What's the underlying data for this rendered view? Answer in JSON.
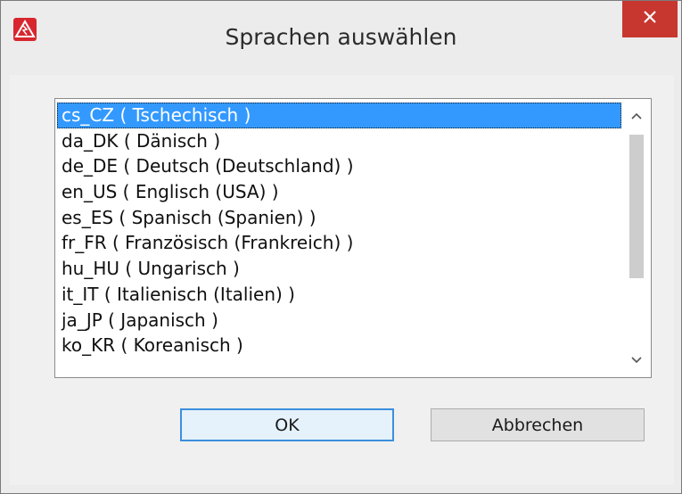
{
  "window": {
    "title": "Sprachen auswählen",
    "app_icon": "warning-triangle-icon",
    "close_icon": "close-icon",
    "accent_color": "#c7372f"
  },
  "list": {
    "selected_index": 0,
    "items": [
      "cs_CZ ( Tschechisch )",
      "da_DK ( Dänisch )",
      "de_DE ( Deutsch (Deutschland) )",
      "en_US ( Englisch (USA) )",
      "es_ES ( Spanisch (Spanien) )",
      "fr_FR ( Französisch (Frankreich) )",
      "hu_HU ( Ungarisch )",
      "it_IT ( Italienisch (Italien) )",
      "ja_JP ( Japanisch )",
      "ko_KR ( Koreanisch )"
    ],
    "selection_color": "#3399ff"
  },
  "buttons": {
    "ok_label": "OK",
    "cancel_label": "Abbrechen"
  }
}
